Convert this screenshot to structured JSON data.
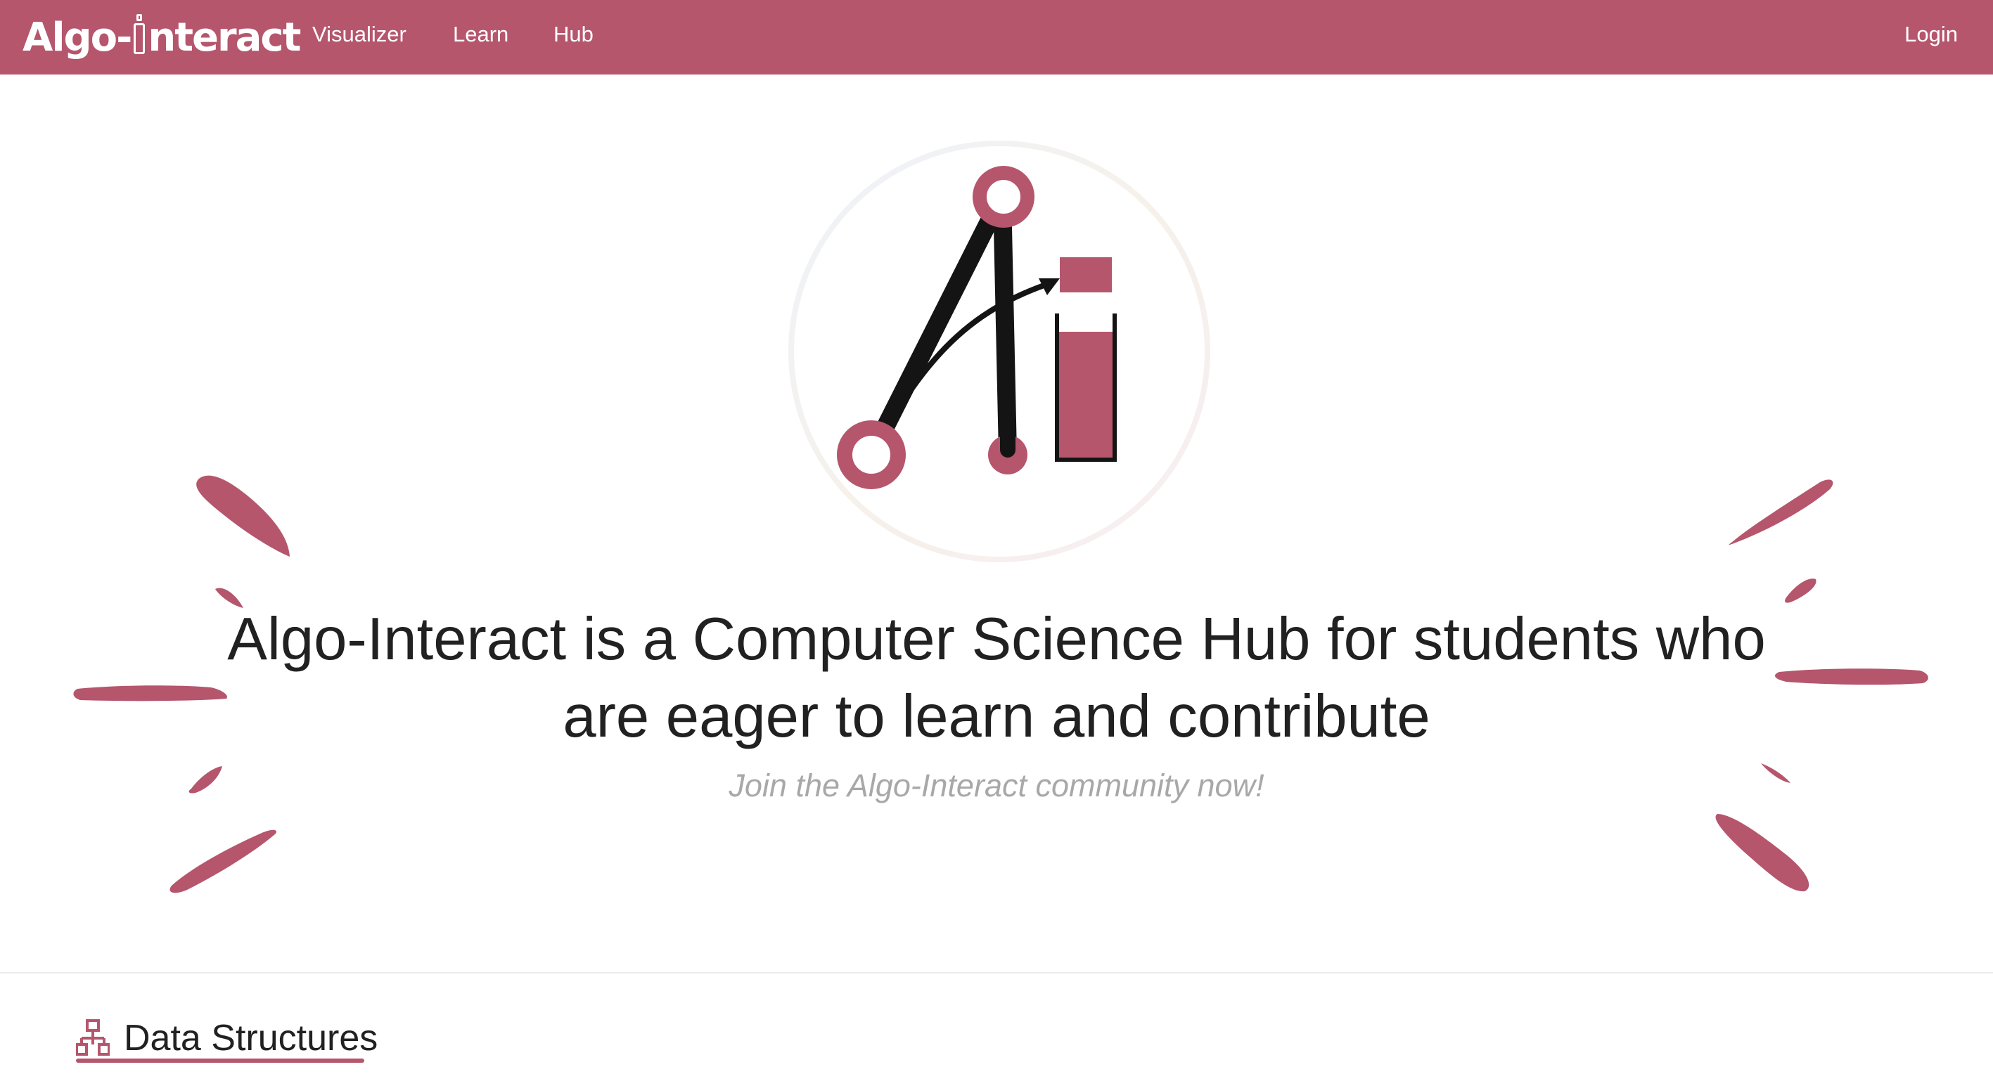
{
  "navbar": {
    "brand_left": "Algo-",
    "brand_right": "nteract",
    "links": [
      "Visualizer",
      "Learn",
      "Hub"
    ],
    "login": "Login"
  },
  "hero": {
    "title": "Algo-Interact is a Computer Science Hub for students who are eager to learn and contribute",
    "subtitle": "Join the Algo-Interact community now!"
  },
  "section": {
    "label": "Data Structures",
    "icon": "sitemap-icon"
  },
  "colors": {
    "brand": "#b5566d",
    "text": "#212121",
    "muted": "#a8a8a8",
    "white": "#ffffff"
  }
}
